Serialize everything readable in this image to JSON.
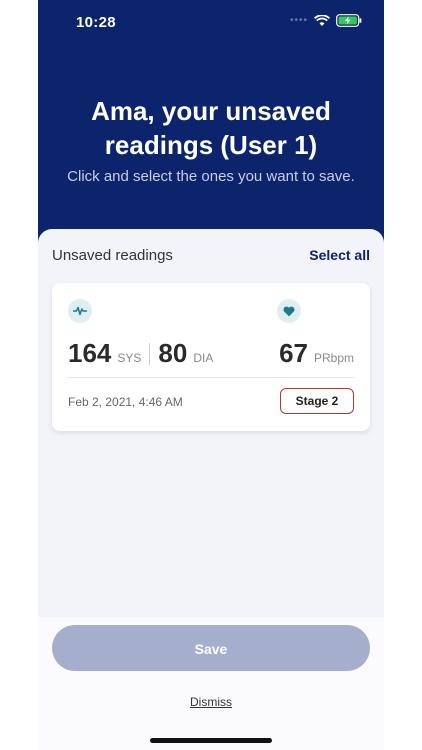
{
  "status_bar": {
    "time": "10:28"
  },
  "header": {
    "title_line1": "Ama, your unsaved",
    "title_line2": "readings (User 1)",
    "subtitle": "Click and select the ones you want to save."
  },
  "sheet": {
    "title": "Unsaved readings",
    "select_all": "Select all"
  },
  "reading": {
    "sys_value": "164",
    "sys_unit": "SYS",
    "dia_value": "80",
    "dia_unit": "DIA",
    "pulse_value": "67",
    "pulse_unit": "PRbpm",
    "datetime": "Feb 2, 2021, 4:46 AM",
    "stage": "Stage 2"
  },
  "footer": {
    "save_label": "Save",
    "dismiss_label": "Dismiss"
  },
  "colors": {
    "primary": "#0b246c",
    "stage_border": "#b63b1e",
    "icon_accent": "#1d7a86",
    "save_disabled": "#a5aecc"
  }
}
